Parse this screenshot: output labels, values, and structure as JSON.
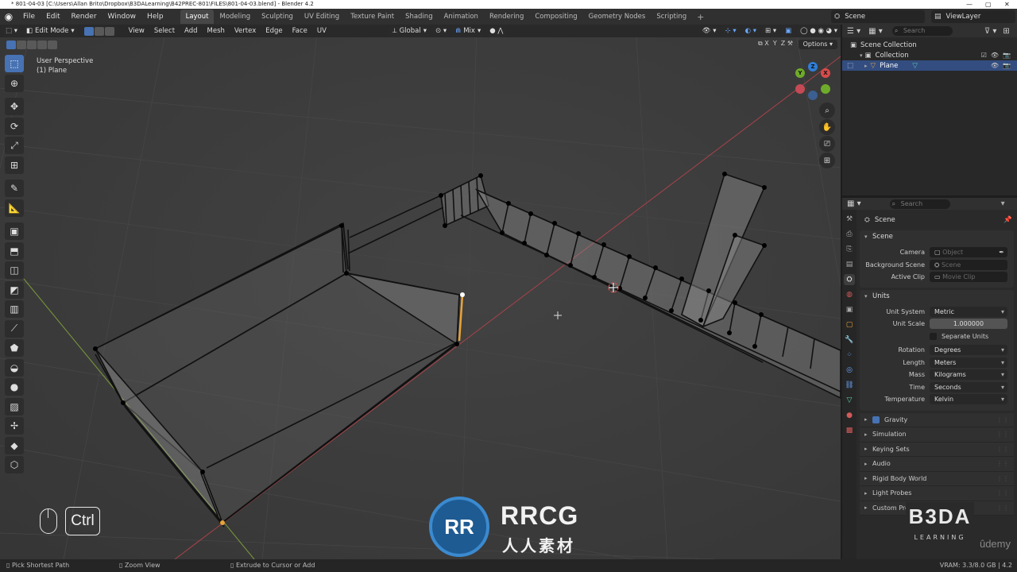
{
  "window": {
    "title": "* 801-04-03 [C:\\Users\\Allan Brito\\Dropbox\\B3DALearning\\B42PREC-801\\FILES\\801-04-03.blend] - Blender 4.2"
  },
  "topbar": {
    "menus": [
      "File",
      "Edit",
      "Render",
      "Window",
      "Help"
    ],
    "workspaces": [
      "Layout",
      "Modeling",
      "Sculpting",
      "UV Editing",
      "Texture Paint",
      "Shading",
      "Animation",
      "Rendering",
      "Compositing",
      "Geometry Nodes",
      "Scripting"
    ],
    "active_workspace": "Layout",
    "scene": "Scene",
    "view_layer": "ViewLayer"
  },
  "viewport": {
    "mode": "Edit Mode",
    "menus": [
      "View",
      "Select",
      "Add",
      "Mesh",
      "Vertex",
      "Edge",
      "Face",
      "UV"
    ],
    "orientation": "Global",
    "snap_mode": "Mix",
    "axis_lock": [
      "X",
      "Y",
      "Z"
    ],
    "options_label": "Options",
    "perspective": "User Perspective",
    "object": "(1) Plane",
    "gizmo": {
      "x": "X",
      "y": "Y",
      "z": "Z"
    },
    "key_overlay": "Ctrl",
    "accent_color": "#4772b3",
    "selected_edge_color": "#e8a33a"
  },
  "watermark": {
    "logo": "RR",
    "text": "RRCG",
    "subtext": "人人素材",
    "brand": "B3DA",
    "brand_sub": "LEARNING",
    "udemy": "ûdemy"
  },
  "outliner": {
    "search_placeholder": "Search",
    "rows": [
      {
        "label": "Scene Collection"
      },
      {
        "label": "Collection"
      },
      {
        "label": "Plane"
      }
    ]
  },
  "properties": {
    "search_placeholder": "Search",
    "context": "Scene",
    "scene_panel": {
      "title": "Scene",
      "camera_label": "Camera",
      "camera_placeholder": "Object",
      "bg_label": "Background Scene",
      "bg_placeholder": "Scene",
      "clip_label": "Active Clip",
      "clip_placeholder": "Movie Clip"
    },
    "units_panel": {
      "title": "Units",
      "rows": [
        {
          "label": "Unit System",
          "value": "Metric"
        },
        {
          "label": "Unit Scale",
          "value": "1.000000"
        }
      ],
      "separate_units": "Separate Units",
      "rows2": [
        {
          "label": "Rotation",
          "value": "Degrees"
        },
        {
          "label": "Length",
          "value": "Meters"
        },
        {
          "label": "Mass",
          "value": "Kilograms"
        },
        {
          "label": "Time",
          "value": "Seconds"
        },
        {
          "label": "Temperature",
          "value": "Kelvin"
        }
      ]
    },
    "collapsed": [
      "Gravity",
      "Simulation",
      "Keying Sets",
      "Audio",
      "Rigid Body World",
      "Light Probes",
      "Custom Properties"
    ]
  },
  "statusbar": {
    "left": "Pick Shortest Path",
    "middle": "Zoom View",
    "right": "Extrude to Cursor or Add",
    "vram": "VRAM: 3.3/8.0 GB | 4.2"
  }
}
